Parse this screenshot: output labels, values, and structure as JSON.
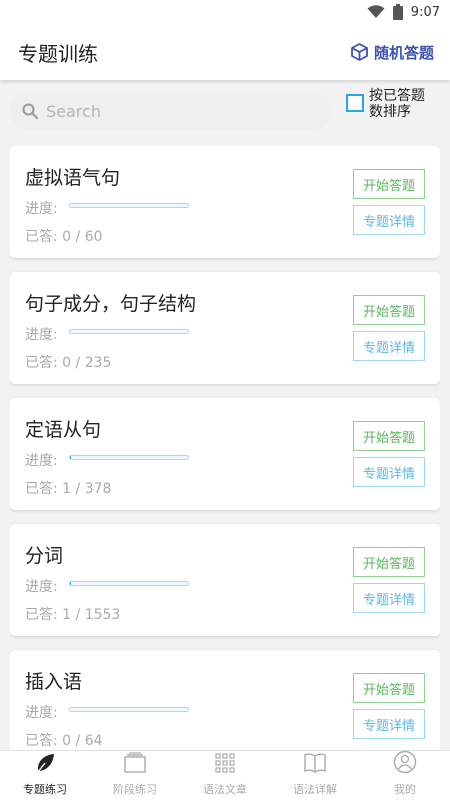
{
  "status": {
    "time": "9:07"
  },
  "appbar": {
    "title": "专题训练",
    "random_label": "随机答题"
  },
  "search": {
    "placeholder": "Search"
  },
  "sort": {
    "label": "按已答题数排序"
  },
  "cards": [
    {
      "title": "虚拟语气句",
      "progress_label": "进度:",
      "progress": 0,
      "answered_label": "已答:",
      "answered": "0 / 60",
      "start_label": "开始答题",
      "detail_label": "专题详情"
    },
    {
      "title": "句子成分，句子结构",
      "progress_label": "进度:",
      "progress": 0,
      "answered_label": "已答:",
      "answered": "0 / 235",
      "start_label": "开始答题",
      "detail_label": "专题详情"
    },
    {
      "title": "定语从句",
      "progress_label": "进度:",
      "progress": 0.003,
      "answered_label": "已答:",
      "answered": "1 / 378",
      "start_label": "开始答题",
      "detail_label": "专题详情"
    },
    {
      "title": "分词",
      "progress_label": "进度:",
      "progress": 0.001,
      "answered_label": "已答:",
      "answered": "1 / 1553",
      "start_label": "开始答题",
      "detail_label": "专题详情"
    },
    {
      "title": "插入语",
      "progress_label": "进度:",
      "progress": 0,
      "answered_label": "已答:",
      "answered": "0 / 64",
      "start_label": "开始答题",
      "detail_label": "专题详情"
    }
  ],
  "tabs": [
    {
      "label": "专题练习",
      "icon": "leaf-icon",
      "active": true
    },
    {
      "label": "阶段练习",
      "icon": "stack-icon",
      "active": false
    },
    {
      "label": "语法文章",
      "icon": "grid-icon",
      "active": false
    },
    {
      "label": "语法详解",
      "icon": "book-icon",
      "active": false
    },
    {
      "label": "我的",
      "icon": "user-icon",
      "active": false
    }
  ],
  "colors": {
    "accent": "#3f51b5",
    "start_green": "#5cb85c",
    "detail_blue": "#5bb7e5",
    "checkbox": "#29a8e0"
  }
}
